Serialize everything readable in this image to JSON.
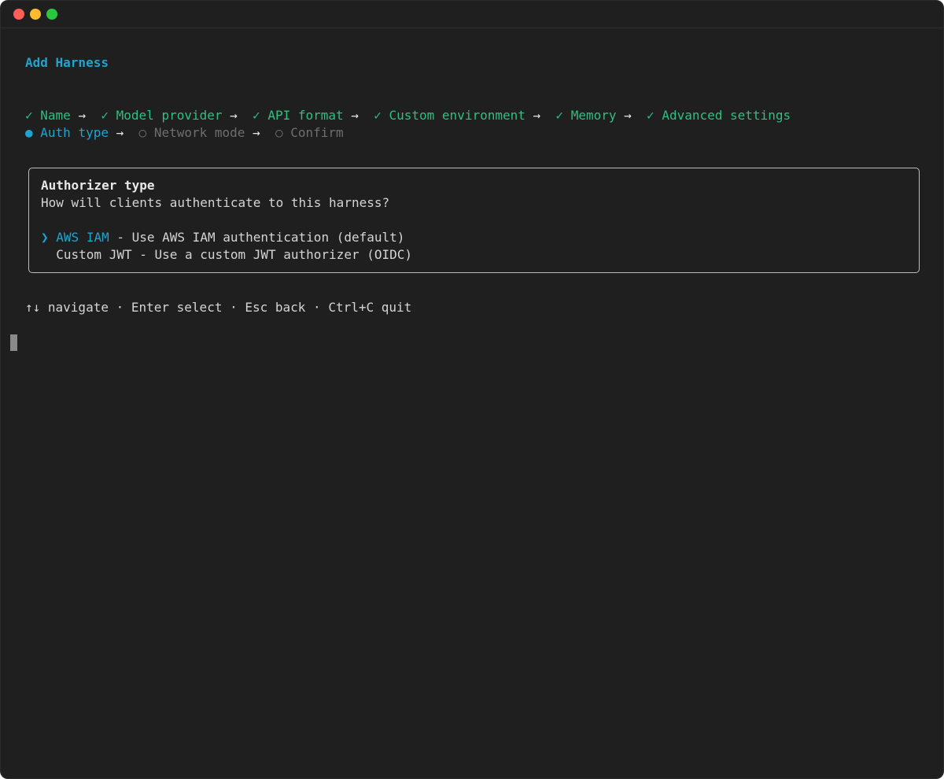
{
  "window": {
    "controls": [
      "close",
      "minimize",
      "maximize"
    ]
  },
  "header": {
    "title": "Add Harness"
  },
  "steps": {
    "completed": [
      {
        "mark": "✓",
        "label": "Name"
      },
      {
        "mark": "✓",
        "label": "Model provider"
      },
      {
        "mark": "✓",
        "label": "API format"
      },
      {
        "mark": "✓",
        "label": "Custom environment"
      },
      {
        "mark": "✓",
        "label": "Memory"
      },
      {
        "mark": "✓",
        "label": "Advanced settings"
      }
    ],
    "current": {
      "mark": "●",
      "label": "Auth type"
    },
    "pending": [
      {
        "mark": "○",
        "label": "Network mode"
      },
      {
        "mark": "○",
        "label": "Confirm"
      }
    ],
    "separator": "→"
  },
  "prompt": {
    "heading": "Authorizer type",
    "question": "How will clients authenticate to this harness?",
    "pointer": "❯",
    "options": [
      {
        "name": "AWS IAM",
        "description": " - Use AWS IAM authentication (default)",
        "selected": true
      },
      {
        "name": "Custom JWT",
        "description": " - Use a custom JWT authorizer (OIDC)",
        "selected": false
      }
    ]
  },
  "footer": {
    "hints": "↑↓ navigate · Enter select · Esc back · Ctrl+C quit"
  },
  "colors": {
    "background": "#1f1f1f",
    "accent": "#1ea4cf",
    "done": "#2fbf7f",
    "pending": "#6e6e6e"
  }
}
